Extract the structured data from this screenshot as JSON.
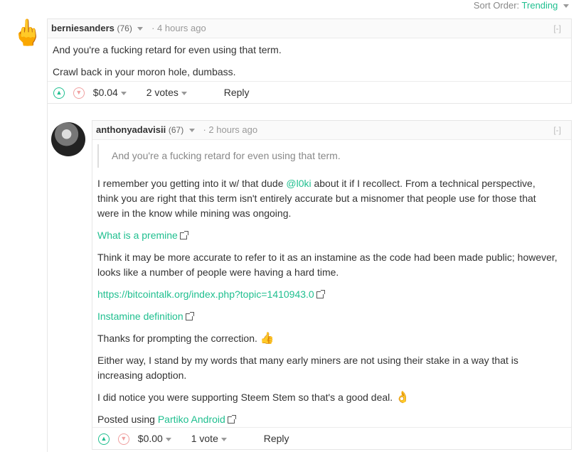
{
  "sort": {
    "label": "Sort Order:",
    "value": "Trending"
  },
  "comment1": {
    "avatar": "middle-finger-emoji",
    "author": "berniesanders",
    "rep": "(76)",
    "time": "4 hours ago",
    "collapse": "[-]",
    "paragraphs": [
      "And you're a fucking retard for even using that term.",
      "Crawl back in your moron hole, dumbass."
    ],
    "payout": "$0.04",
    "votes": "2 votes",
    "reply": "Reply"
  },
  "comment2": {
    "author": "anthonyadavisii",
    "rep": "(67)",
    "time": "2 hours ago",
    "collapse": "[-]",
    "quote": "And you're a fucking retard for even using that term.",
    "p1_a": "I remember you getting into it w/ that dude ",
    "mention": "@l0ki",
    "p1_b": " about it if I recollect. From a technical perspective, think you are right that this term isn't entirely accurate but a misnomer that people use for those that were in the know while mining was ongoing.",
    "link1": "What is a premine",
    "p2": "Think it may be more accurate to refer to it as an instamine as the code had been made public; however, looks like a number of people were having a hard time.",
    "link2": "https://bitcointalk.org/index.php?topic=1410943.0",
    "link3": "Instamine definition",
    "p3": "Thanks for prompting the correction. ",
    "emoji_thumbs": "👍",
    "p4": "Either way, I stand by my words that many early miners are not using their stake in a way that is increasing adoption.",
    "p5": "I did notice you were supporting Steem Stem so that's a good deal. ",
    "emoji_ok": "👌",
    "posted": "Posted using ",
    "link4": "Partiko Android",
    "payout": "$0.00",
    "votes": "1 vote",
    "reply": "Reply"
  },
  "colors": {
    "accent": "#1fbf8f",
    "downvote": "#f0a0a0"
  }
}
